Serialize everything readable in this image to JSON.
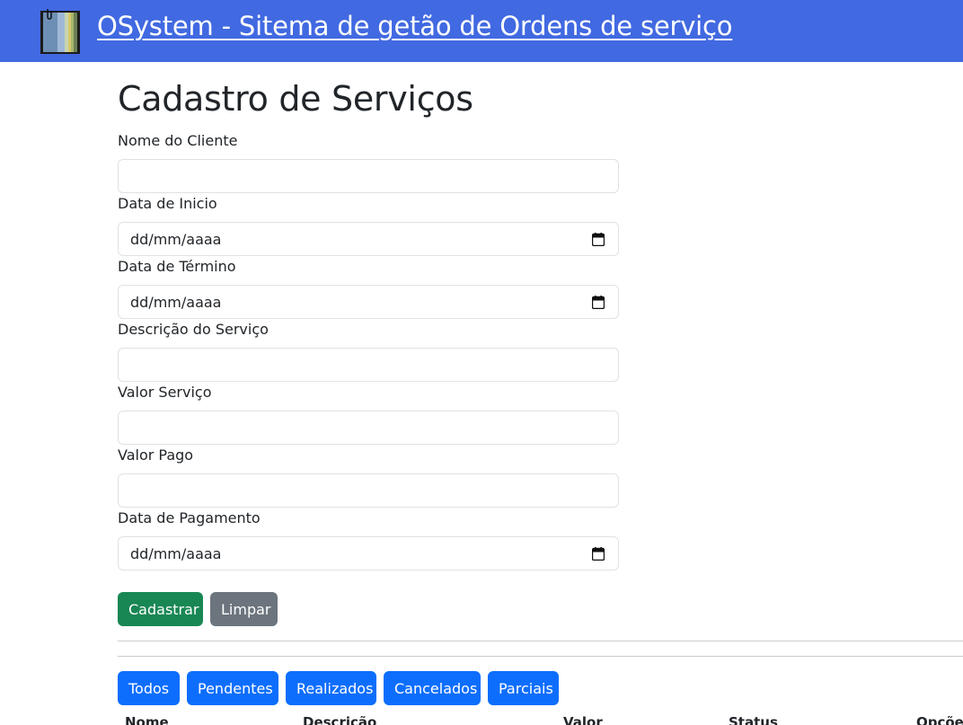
{
  "header": {
    "title": "OSystem - Sitema de getão de Ordens de serviço",
    "logo_icon": "notebook-icon",
    "background": "#4169e1"
  },
  "page": {
    "title": "Cadastro de Serviços"
  },
  "form": {
    "client_name": {
      "label": "Nome do Cliente",
      "value": ""
    },
    "start_date": {
      "label": "Data de Inicio",
      "placeholder": "dd/mm/aaaa",
      "icon": "calendar-icon"
    },
    "end_date": {
      "label": "Data de Término",
      "placeholder": "dd/mm/aaaa",
      "icon": "calendar-icon"
    },
    "description": {
      "label": "Descrição do Serviço",
      "value": ""
    },
    "service_value": {
      "label": "Valor Serviço",
      "value": ""
    },
    "paid_value": {
      "label": "Valor Pago",
      "value": ""
    },
    "payment_date": {
      "label": "Data de Pagamento",
      "placeholder": "dd/mm/aaaa",
      "icon": "calendar-icon"
    },
    "submit_label": "Cadastrar",
    "clear_label": "Limpar"
  },
  "filters": [
    "Todos",
    "Pendentes",
    "Realizados",
    "Cancelados",
    "Parciais"
  ],
  "table": {
    "columns": [
      "Nome",
      "Descrição",
      "Valor",
      "Status",
      "Opções"
    ]
  },
  "colors": {
    "primary": "#0d6efd",
    "success": "#198754",
    "secondary": "#6c757d"
  }
}
